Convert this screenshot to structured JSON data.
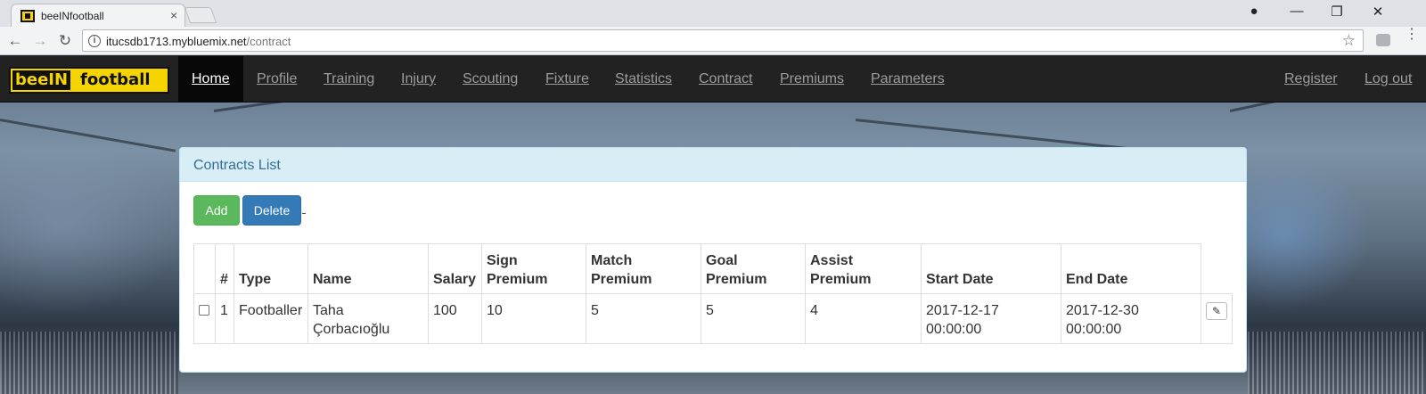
{
  "browser": {
    "tab_title": "beeINfootball",
    "tab_close": "×",
    "url_host": "itucsdb1713.mybluemix.net",
    "url_path": "/contract",
    "window_controls": {
      "profile": "●",
      "minimize": "—",
      "restore": "❐",
      "close": "✕"
    },
    "nav_icons": {
      "back": "←",
      "forward": "→",
      "reload": "↻",
      "info": "i",
      "star": "☆",
      "menu": "⋮"
    }
  },
  "navbar": {
    "brand_left": "beeIN",
    "brand_right": "football",
    "links": [
      {
        "label": "Home",
        "active": true
      },
      {
        "label": "Profile"
      },
      {
        "label": "Training"
      },
      {
        "label": "Injury"
      },
      {
        "label": "Scouting"
      },
      {
        "label": "Fixture"
      },
      {
        "label": "Statistics"
      },
      {
        "label": "Contract"
      },
      {
        "label": "Premiums"
      },
      {
        "label": "Parameters"
      }
    ],
    "right_links": [
      {
        "label": "Register"
      },
      {
        "label": "Log out"
      }
    ]
  },
  "panel": {
    "title": "Contracts List",
    "add_label": "Add",
    "delete_label": "Delete"
  },
  "table": {
    "headers": {
      "num": "#",
      "type": "Type",
      "name": "Name",
      "salary": "Salary",
      "sign_premium_1": "Sign",
      "sign_premium_2": "Premium",
      "match_premium_1": "Match",
      "match_premium_2": "Premium",
      "goal_premium_1": "Goal",
      "goal_premium_2": "Premium",
      "assist_premium_1": "Assist",
      "assist_premium_2": "Premium",
      "start_date": "Start Date",
      "end_date": "End Date"
    },
    "rows": [
      {
        "num": "1",
        "type": "Footballer",
        "name_1": "Taha",
        "name_2": "Çorbacıoğlu",
        "salary": "100",
        "sign_premium": "10",
        "match_premium": "5",
        "goal_premium": "5",
        "assist_premium": "4",
        "start_date_1": "2017-12-17",
        "start_date_2": "00:00:00",
        "end_date_1": "2017-12-30",
        "end_date_2": "00:00:00",
        "edit_icon": "✎"
      }
    ]
  },
  "colors": {
    "navbar_bg": "#222222",
    "brand_yellow": "#f5d400",
    "panel_heading_bg": "#d9edf7",
    "panel_title": "#31708f",
    "add_green": "#5cb85c",
    "delete_blue": "#337ab7"
  }
}
